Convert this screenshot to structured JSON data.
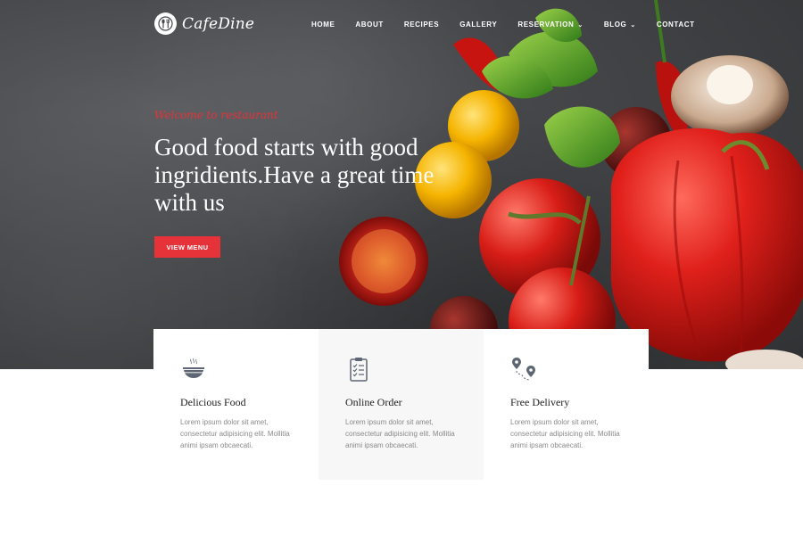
{
  "brand": {
    "name": "CafeDine"
  },
  "nav": {
    "items": [
      {
        "label": "HOME",
        "dropdown": false
      },
      {
        "label": "ABOUT",
        "dropdown": false
      },
      {
        "label": "RECIPES",
        "dropdown": false
      },
      {
        "label": "GALLERY",
        "dropdown": false
      },
      {
        "label": "RESERVATION",
        "dropdown": true
      },
      {
        "label": "BLOG",
        "dropdown": true
      },
      {
        "label": "CONTACT",
        "dropdown": false
      }
    ]
  },
  "hero": {
    "kicker": "Welcome to restaurant",
    "headline": "Good food starts with good ingridients.Have a great time with us",
    "cta_label": "VIEW MENU"
  },
  "features": [
    {
      "icon": "food-bowl-icon",
      "title": "Delicious Food",
      "text": "Lorem ipsum dolor sit amet, consectetur adipisicing elit. Mollitia animi ipsam obcaecati."
    },
    {
      "icon": "clipboard-checklist-icon",
      "title": "Online Order",
      "text": "Lorem ipsum dolor sit amet, consectetur adipisicing elit. Mollitia animi ipsam obcaecati."
    },
    {
      "icon": "map-pins-route-icon",
      "title": "Free Delivery",
      "text": "Lorem ipsum dolor sit amet, consectetur adipisicing elit. Mollitia animi ipsam obcaecati."
    }
  ],
  "colors": {
    "accent": "#e63239",
    "hero_bg": "#45474a",
    "text_muted": "#8a8a8a"
  }
}
